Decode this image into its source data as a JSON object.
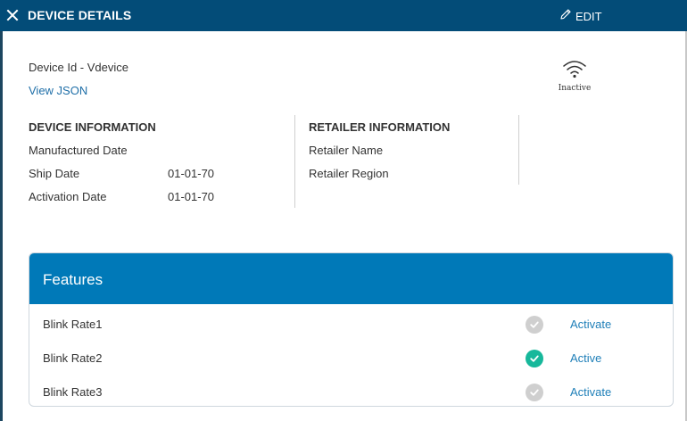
{
  "header": {
    "title": "DEVICE DETAILS",
    "edit_label": "EDIT",
    "close_icon": "close-icon",
    "edit_icon": "pencil-icon"
  },
  "device": {
    "id_text": "Device Id - Vdevice",
    "view_json_label": "View JSON",
    "status_icon": "wifi-icon",
    "status_text": "Inactive"
  },
  "device_information": {
    "title": "DEVICE INFORMATION",
    "fields": [
      {
        "label": "Manufactured Date",
        "value": ""
      },
      {
        "label": "Ship Date",
        "value": "01-01-70"
      },
      {
        "label": "Activation Date",
        "value": "01-01-70"
      }
    ]
  },
  "retailer_information": {
    "title": "RETAILER INFORMATION",
    "fields": [
      {
        "label": "Retailer Name",
        "value": ""
      },
      {
        "label": "Retailer Region",
        "value": ""
      }
    ]
  },
  "features": {
    "title": "Features",
    "items": [
      {
        "name": "Blink Rate1",
        "active": false,
        "action": "Activate"
      },
      {
        "name": "Blink Rate2",
        "active": true,
        "action": "Active"
      },
      {
        "name": "Blink Rate3",
        "active": false,
        "action": "Activate"
      }
    ]
  },
  "colors": {
    "header_bg": "#034c78",
    "features_header_bg": "#0079b8",
    "link": "#1f6fa8",
    "check_active": "#17b89b",
    "check_inactive": "#cfcfcf"
  }
}
